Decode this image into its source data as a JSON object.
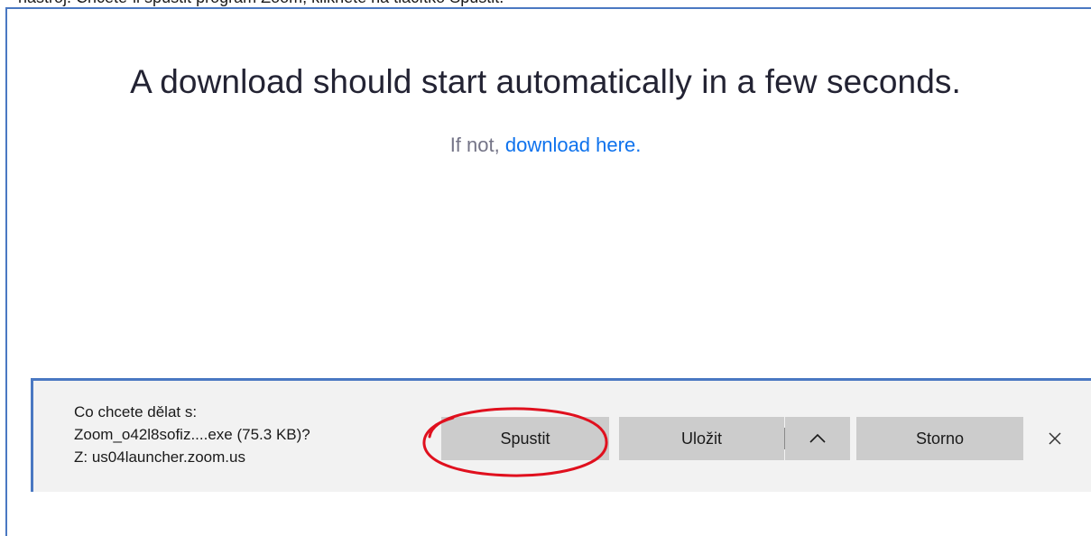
{
  "top_caption": "nastroj. Chcete-li spustit program Zoom, klikněte na tlačítko Spustit.",
  "page": {
    "headline": "A download should start automatically in a few seconds.",
    "fallback_prefix": "If not,",
    "fallback_link": "download here."
  },
  "download_bar": {
    "question_line1": "Co chcete dělat s:",
    "question_line2": "Zoom_o42l8sofiz....exe (75.3 KB)?",
    "question_line3": "Z: us04launcher.zoom.us",
    "run_label": "Spustit",
    "save_label": "Uložit",
    "more_icon": "chevron-up-icon",
    "cancel_label": "Storno",
    "close_icon": "close-icon"
  },
  "annotation": {
    "highlight_color": "#e0101e",
    "highlight_target": "Spustit"
  },
  "colors": {
    "link": "#0e72ed",
    "frame_accent": "#4a78c2",
    "bar_background": "#f2f2f2",
    "button_background": "#cccccc"
  }
}
